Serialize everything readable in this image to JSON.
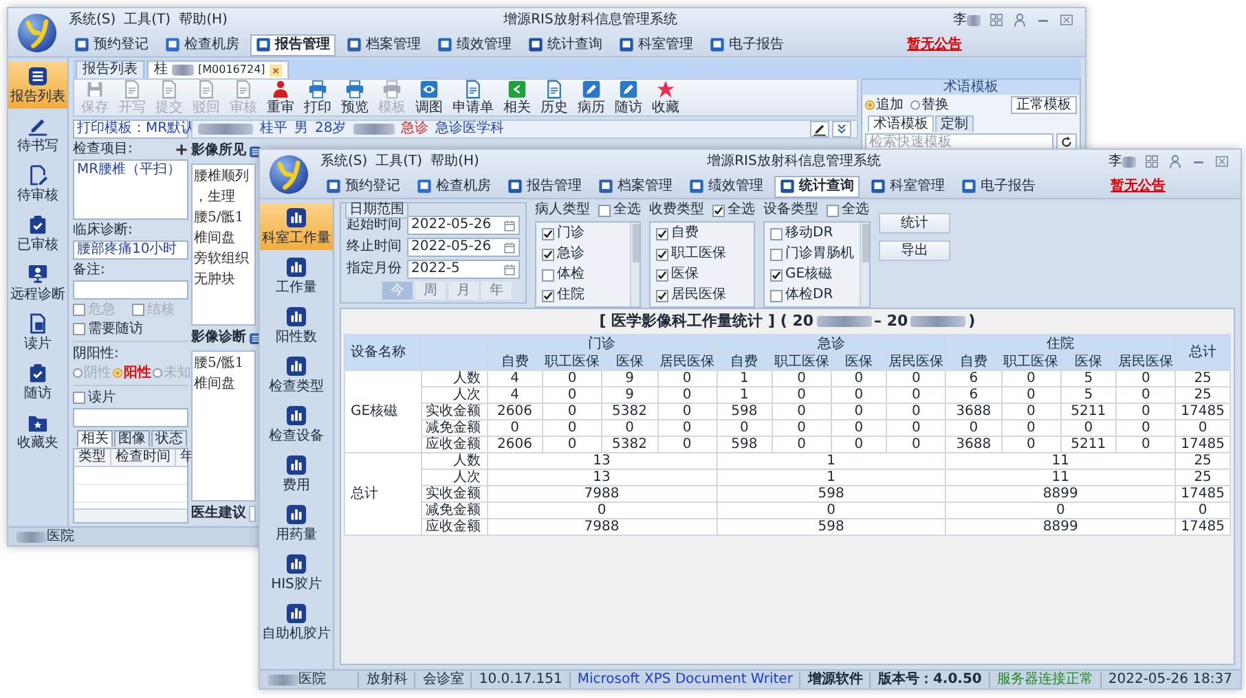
{
  "back_window": {
    "menu": [
      "系统(S)",
      "工具(T)",
      "帮助(H)"
    ],
    "title": "增源RIS放射科信息管理系统",
    "user": "李",
    "notice": "暂无公告",
    "nav": [
      {
        "label": "预约登记",
        "selected": false
      },
      {
        "label": "检查机房",
        "selected": false
      },
      {
        "label": "报告管理",
        "selected": true
      },
      {
        "label": "档案管理",
        "selected": false
      },
      {
        "label": "绩效管理",
        "selected": false
      },
      {
        "label": "统计查询",
        "selected": false
      },
      {
        "label": "科室管理",
        "selected": false
      },
      {
        "label": "电子报告",
        "selected": false
      }
    ],
    "sidebar": [
      {
        "label": "报告列表",
        "selected": true
      },
      {
        "label": "待书写",
        "selected": false
      },
      {
        "label": "待审核",
        "selected": false
      },
      {
        "label": "已审核",
        "selected": false
      },
      {
        "label": "远程诊断",
        "selected": false
      },
      {
        "label": "读片",
        "selected": false
      },
      {
        "label": "随访",
        "selected": false
      },
      {
        "label": "收藏夹",
        "selected": false
      }
    ],
    "doc_tabs": [
      {
        "label": "报告列表",
        "selected": false
      },
      {
        "label": "桂",
        "suffix": "[M0016724]",
        "selected": true
      }
    ],
    "toolbar": [
      {
        "label": "保存",
        "disabled": true
      },
      {
        "label": "开写",
        "disabled": true
      },
      {
        "label": "提交",
        "disabled": true
      },
      {
        "label": "驳回",
        "disabled": true
      },
      {
        "label": "审核",
        "disabled": true
      },
      {
        "label": "重审",
        "disabled": false
      },
      {
        "label": "打印",
        "disabled": false
      },
      {
        "label": "预览",
        "disabled": false
      },
      {
        "label": "模板",
        "disabled": true
      },
      {
        "label": "调图",
        "disabled": false
      },
      {
        "label": "申请单",
        "disabled": false
      },
      {
        "label": "相关",
        "disabled": false
      },
      {
        "label": "历史",
        "disabled": false
      },
      {
        "label": "病历",
        "disabled": false
      },
      {
        "label": "随访",
        "disabled": false
      },
      {
        "label": "收藏",
        "disabled": false
      }
    ],
    "template_panel": {
      "title": "术语模板",
      "modes": [
        {
          "label": "追加",
          "selected": true
        },
        {
          "label": "替换",
          "selected": false
        }
      ],
      "button": "正常模板",
      "tabs": [
        {
          "label": "术语模板",
          "selected": true
        },
        {
          "label": "定制",
          "selected": false
        }
      ],
      "placeholder": "检索快速模板"
    },
    "print_template": "打印模板：MR默认",
    "exam_label": "检查项目:",
    "exams": [
      "MR腰椎（平扫）"
    ],
    "clinical_label": "临床诊断:",
    "clinical_value": "腰部疼痛10小时",
    "remark_label": "备注:",
    "flags": [
      {
        "label": "危急",
        "checked": false,
        "disabled": true
      },
      {
        "label": "结核",
        "checked": false,
        "disabled": true
      },
      {
        "label": "需要随访",
        "checked": false,
        "disabled": false
      }
    ],
    "polarity_label": "阴阳性:",
    "polarity": [
      {
        "label": "阴性",
        "selected": false
      },
      {
        "label": "阳性",
        "selected": true
      },
      {
        "label": "未知",
        "selected": false
      }
    ],
    "read_film": {
      "label": "读片",
      "checked": false
    },
    "related_tabs": [
      {
        "label": "相关",
        "selected": true
      },
      {
        "label": "图像",
        "selected": false
      },
      {
        "label": "状态",
        "selected": false
      }
    ],
    "related_columns": [
      "类型",
      "检查时间",
      "年"
    ],
    "patient": {
      "name": "桂平",
      "sex": "男",
      "age": "28岁",
      "visit": "急诊",
      "dept": "急诊医学科"
    },
    "findings": {
      "title": "影像所见",
      "lines": [
        "腰椎顺列，生理",
        "腰5/骶1椎间盘",
        "旁软组织无肿块"
      ]
    },
    "diagnosis": {
      "title": "影像诊断",
      "lines": [
        "腰5/骶1椎间盘"
      ]
    },
    "advice_label": "医生建议",
    "status": {
      "hospital": "医院"
    }
  },
  "front_window": {
    "menu": [
      "系统(S)",
      "工具(T)",
      "帮助(H)"
    ],
    "title": "增源RIS放射科信息管理系统",
    "user": "李",
    "notice": "暂无公告",
    "nav": [
      {
        "label": "预约登记",
        "selected": false
      },
      {
        "label": "检查机房",
        "selected": false
      },
      {
        "label": "报告管理",
        "selected": false
      },
      {
        "label": "档案管理",
        "selected": false
      },
      {
        "label": "绩效管理",
        "selected": false
      },
      {
        "label": "统计查询",
        "selected": true
      },
      {
        "label": "科室管理",
        "selected": false
      },
      {
        "label": "电子报告",
        "selected": false
      }
    ],
    "sidebar": [
      {
        "label": "科室工作量",
        "selected": true
      },
      {
        "label": "工作量",
        "selected": false
      },
      {
        "label": "阳性数",
        "selected": false
      },
      {
        "label": "检查类型",
        "selected": false
      },
      {
        "label": "检查设备",
        "selected": false
      },
      {
        "label": "费用",
        "selected": false
      },
      {
        "label": "用药量",
        "selected": false
      },
      {
        "label": "HIS胶片",
        "selected": false
      },
      {
        "label": "自助机胶片",
        "selected": false
      }
    ],
    "date_range": {
      "title": "日期范围",
      "fields": [
        {
          "label": "起始时间",
          "value": "2022-05-26"
        },
        {
          "label": "终止时间",
          "value": "2022-05-26"
        },
        {
          "label": "指定月份",
          "value": "2022-5"
        }
      ],
      "periods": [
        {
          "label": "今",
          "selected": true
        },
        {
          "label": "周",
          "selected": false
        },
        {
          "label": "月",
          "selected": false
        },
        {
          "label": "年",
          "selected": false
        }
      ]
    },
    "filters": [
      {
        "title": "病人类型",
        "all_label": "全选",
        "all_checked": false,
        "scrollable": true,
        "options": [
          {
            "label": "门诊",
            "checked": true
          },
          {
            "label": "急诊",
            "checked": true
          },
          {
            "label": "体检",
            "checked": false
          },
          {
            "label": "住院",
            "checked": true
          }
        ]
      },
      {
        "title": "收费类型",
        "all_label": "全选",
        "all_checked": true,
        "scrollable": false,
        "options": [
          {
            "label": "自费",
            "checked": true
          },
          {
            "label": "职工医保",
            "checked": true
          },
          {
            "label": "医保",
            "checked": true
          },
          {
            "label": "居民医保",
            "checked": true
          }
        ]
      },
      {
        "title": "设备类型",
        "all_label": "全选",
        "all_checked": false,
        "scrollable": true,
        "options": [
          {
            "label": "移动DR",
            "checked": false
          },
          {
            "label": "门诊胃肠机",
            "checked": false
          },
          {
            "label": "GE核磁",
            "checked": true
          },
          {
            "label": "体检DR",
            "checked": false
          }
        ]
      }
    ],
    "actions": [
      "统计",
      "导出"
    ],
    "table": {
      "title": "[ 医学影像科工作量统计 ] ( 20",
      "title_mid": "– 20",
      "title_end": ")",
      "device_header": "设备名称",
      "total_header": "总计",
      "groups": [
        {
          "label": "门诊",
          "columns": [
            "自费",
            "职工医保",
            "医保",
            "居民医保"
          ]
        },
        {
          "label": "急诊",
          "columns": [
            "自费",
            "职工医保",
            "医保",
            "居民医保"
          ]
        },
        {
          "label": "住院",
          "columns": [
            "自费",
            "职工医保",
            "医保",
            "居民医保"
          ]
        }
      ],
      "sections": [
        {
          "device": "GE核磁",
          "kind": "detail",
          "rows": [
            {
              "metric": "人数",
              "values": [
                "4",
                "0",
                "9",
                "0",
                "1",
                "0",
                "0",
                "0",
                "6",
                "0",
                "5",
                "0"
              ],
              "total": "25"
            },
            {
              "metric": "人次",
              "values": [
                "4",
                "0",
                "9",
                "0",
                "1",
                "0",
                "0",
                "0",
                "6",
                "0",
                "5",
                "0"
              ],
              "total": "25"
            },
            {
              "metric": "实收金额",
              "values": [
                "2606",
                "0",
                "5382",
                "0",
                "598",
                "0",
                "0",
                "0",
                "3688",
                "0",
                "5211",
                "0"
              ],
              "total": "17485"
            },
            {
              "metric": "减免金额",
              "values": [
                "0",
                "0",
                "0",
                "0",
                "0",
                "0",
                "0",
                "0",
                "0",
                "0",
                "0",
                "0"
              ],
              "total": "0"
            },
            {
              "metric": "应收金额",
              "values": [
                "2606",
                "0",
                "5382",
                "0",
                "598",
                "0",
                "0",
                "0",
                "3688",
                "0",
                "5211",
                "0"
              ],
              "total": "17485"
            }
          ]
        },
        {
          "device": "总计",
          "kind": "summary",
          "rows": [
            {
              "metric": "人数",
              "values": [
                "13",
                "1",
                "11"
              ],
              "total": "25"
            },
            {
              "metric": "人次",
              "values": [
                "13",
                "1",
                "11"
              ],
              "total": "25"
            },
            {
              "metric": "实收金额",
              "values": [
                "7988",
                "598",
                "8899"
              ],
              "total": "17485"
            },
            {
              "metric": "减免金额",
              "values": [
                "0",
                "0",
                "0"
              ],
              "total": "0"
            },
            {
              "metric": "应收金额",
              "values": [
                "7988",
                "598",
                "8899"
              ],
              "total": "17485"
            }
          ]
        }
      ]
    },
    "status": {
      "hospital": "医院",
      "items": [
        {
          "text": "放射科",
          "kind": "plain"
        },
        {
          "text": "会诊室",
          "kind": "plain"
        },
        {
          "text": "10.0.17.151",
          "kind": "plain"
        },
        {
          "text": "Microsoft XPS Document Writer",
          "kind": "link"
        },
        {
          "text": "增源软件",
          "kind": "bold"
        },
        {
          "text": "版本号：4.0.50",
          "kind": "bold"
        },
        {
          "text": "服务器连接正常",
          "kind": "ok"
        },
        {
          "text": "2022-05-26 18:37",
          "kind": "plain"
        }
      ]
    }
  }
}
